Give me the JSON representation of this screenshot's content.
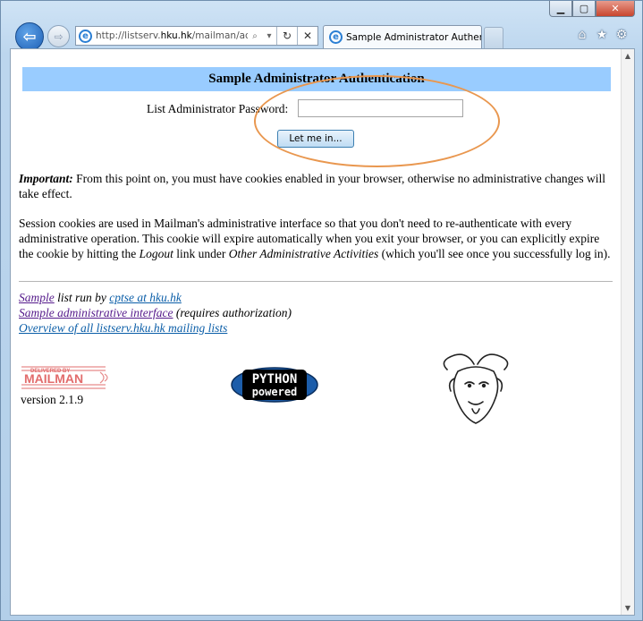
{
  "browser": {
    "address_prefix": "http://listserv.",
    "address_domain": "hku.hk",
    "address_rest": "/mailman/admi",
    "tab_title": "Sample Administrator Authen...",
    "window_buttons": {
      "minimize": "▁",
      "maximize": "▢",
      "close": "✕"
    },
    "nav": {
      "back": "⇦",
      "forward": "⇨"
    },
    "address_tools": {
      "search": "⌕",
      "dropdown": "▾",
      "refresh": "↻",
      "stop": "✕"
    },
    "toolbar_icons": {
      "home": "⌂",
      "favorites": "★",
      "tools": "⚙"
    },
    "scroll_up": "▲",
    "scroll_down": "▼"
  },
  "page": {
    "heading": "Sample Administrator Authentication",
    "password_label": "List Administrator Password:",
    "password_value": "",
    "login_button": "Let me in...",
    "important_label": "Important:",
    "important_text": " From this point on, you must have cookies enabled in your browser, otherwise no administrative changes will take effect.",
    "session_text_1": "Session cookies are used in Mailman's administrative interface so that you don't need to re-authenticate with every administrative operation. This cookie will expire automatically when you exit your browser, or you can explicitly expire the cookie by hitting the ",
    "logout_text": "Logout",
    "session_text_2": " link under ",
    "other_admin_text": "Other Administrative Activities",
    "session_text_3": " (which you'll see once you successfully log in).",
    "footer": {
      "list_link": "Sample",
      "list_run_by": " list run by ",
      "owner_link": "cptse at hku.hk",
      "admin_link": "Sample administrative interface",
      "admin_note": " (requires authorization)",
      "overview_link": "Overview of all listserv.hku.hk mailing lists",
      "version": "version 2.1.9",
      "mailman_logo_text": "MAILMAN",
      "mailman_logo_subtext": "DELIVERED BY",
      "python_logo_line1": "PYTHON",
      "python_logo_line2": "powered"
    }
  },
  "colors": {
    "heading_bg": "#99ccff",
    "visited_link": "#551a8b",
    "link": "#0b5ea8",
    "highlight_ellipse": "#e9974f"
  }
}
